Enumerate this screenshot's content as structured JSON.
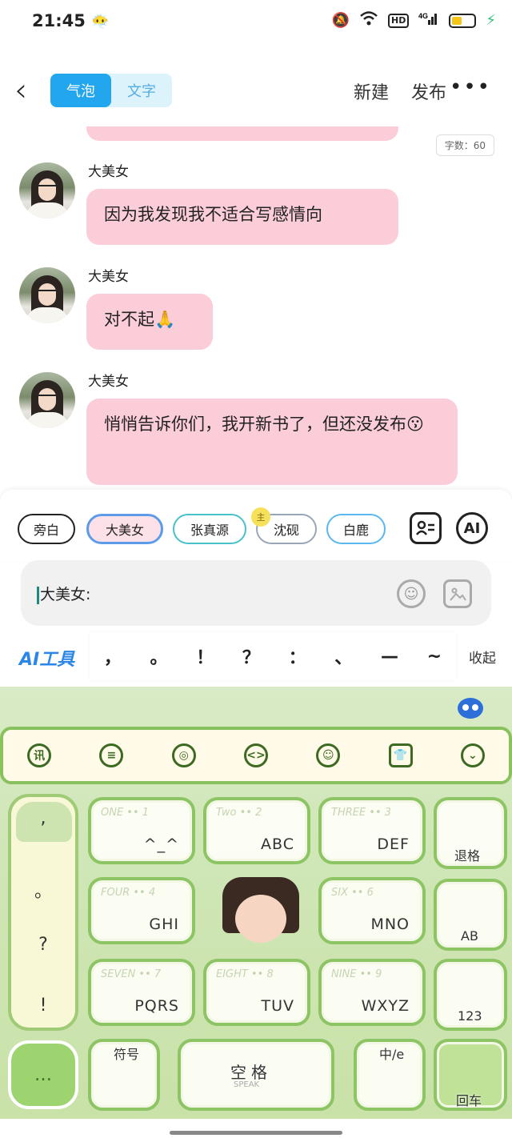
{
  "status": {
    "time": "21:45",
    "emoji": "😶‍🌫️",
    "signal": "4G",
    "hd": "HD"
  },
  "header": {
    "back_icon": "chevron-left-icon",
    "tabs": [
      {
        "label": "气泡",
        "active": true
      },
      {
        "label": "文字",
        "active": false
      }
    ],
    "new_label": "新建",
    "publish_label": "发布",
    "more_label": "•••"
  },
  "chat": {
    "word_count": "字数：60",
    "messages": [
      {
        "name": "大美女",
        "text": "因为我发现我不适合写感情向"
      },
      {
        "name": "大美女",
        "text": "对不起🙏"
      },
      {
        "name": "大美女",
        "text": "悄悄告诉你们，我开新书了，但还没发布😗"
      }
    ]
  },
  "speakers": {
    "chips": [
      "旁白",
      "大美女",
      "张真源",
      "沈砚",
      "白鹿"
    ],
    "owner_badge": "主",
    "ai_label": "AI"
  },
  "input": {
    "value": "大美女:"
  },
  "punct": {
    "ai_tools_label": "AI工具",
    "marks": [
      "，",
      "。",
      "！",
      "？",
      "：",
      "、",
      "—",
      "~"
    ],
    "collapse_label": "收起"
  },
  "keyboard": {
    "side": [
      ",",
      "。",
      "?",
      "!"
    ],
    "keys": [
      {
        "en": "ONE •• 1",
        "letters": "^_^"
      },
      {
        "en": "Two •• 2",
        "letters": "ABC"
      },
      {
        "en": "THREE •• 3",
        "letters": "DEF"
      },
      {
        "en": "FOUR •• 4",
        "letters": "GHI"
      },
      {
        "en": "SIX •• 6",
        "letters": "MNO"
      },
      {
        "en": "SEVEN •• 7",
        "letters": "PQRS"
      },
      {
        "en": "EIGHT •• 8",
        "letters": "TUV"
      },
      {
        "en": "NINE •• 9",
        "letters": "WXYZ"
      }
    ],
    "right_keys": [
      "退格",
      "AB",
      "123",
      "回车"
    ],
    "bottom": {
      "more": "…",
      "symbol": "符号",
      "space": "空格",
      "space_sub": "SPEAK",
      "lang": "中/e"
    }
  }
}
